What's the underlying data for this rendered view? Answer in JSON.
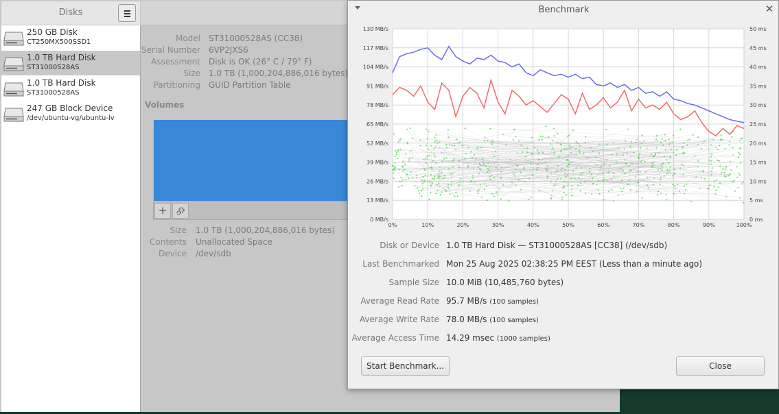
{
  "sidebar": {
    "title": "Disks",
    "disks": [
      {
        "name": "250 GB Disk",
        "sub": "CT250MX500SSD1"
      },
      {
        "name": "1.0 TB Hard Disk",
        "sub": "ST31000528AS"
      },
      {
        "name": "1.0 TB Hard Disk",
        "sub": "ST31000528AS"
      },
      {
        "name": "247 GB Block Device",
        "sub": "/dev/ubuntu-vg/ubuntu-lv"
      }
    ]
  },
  "details": {
    "model_label": "Model",
    "model": "ST31000528AS (CC38)",
    "serial_label": "Serial Number",
    "serial": "6VP2JXS6",
    "assessment_label": "Assessment",
    "assessment": "Disk is OK (26° C / 79° F)",
    "size_label": "Size",
    "size": "1.0 TB (1,000,204,886,016 bytes)",
    "partitioning_label": "Partitioning",
    "partitioning": "GUID Partition Table"
  },
  "volumes": {
    "heading": "Volumes",
    "add_label": "+",
    "size_label": "Size",
    "size": "1.0 TB (1,000,204,886,016 bytes)",
    "contents_label": "Contents",
    "contents": "Unallocated Space",
    "device_label": "Device",
    "device": "/dev/sdb"
  },
  "benchmark": {
    "title": "Benchmark",
    "disk_label": "Disk or Device",
    "disk": "1.0 TB Hard Disk — ST31000528AS [CC38] (/dev/sdb)",
    "last_label": "Last Benchmarked",
    "last": "Mon 25 Aug 2025 02:38:25 PM EEST (Less than a minute ago)",
    "sample_size_label": "Sample Size",
    "sample_size": "10.0 MiB (10,485,760 bytes)",
    "read_label": "Average Read Rate",
    "read": "95.7 MB/s",
    "read_samples": "(100 samples)",
    "write_label": "Average Write Rate",
    "write": "78.0 MB/s",
    "write_samples": "(100 samples)",
    "access_label": "Average Access Time",
    "access": "14.29 msec",
    "access_samples": "(1000 samples)",
    "start_button": "Start Benchmark...",
    "close_button": "Close"
  },
  "chart_data": {
    "type": "line",
    "x_unit": "%",
    "x_ticks": [
      "0%",
      "10%",
      "20%",
      "30%",
      "40%",
      "50%",
      "60%",
      "70%",
      "80%",
      "90%",
      "100%"
    ],
    "y_left_ticks": [
      "0 MB/s",
      "13 MB/s",
      "26 MB/s",
      "39 MB/s",
      "52 MB/s",
      "65 MB/s",
      "78 MB/s",
      "91 MB/s",
      "104 MB/s",
      "117 MB/s",
      "130 MB/s"
    ],
    "y_right_ticks": [
      "0 ms",
      "5 ms",
      "10 ms",
      "15 ms",
      "20 ms",
      "25 ms",
      "30 ms",
      "35 ms",
      "40 ms",
      "45 ms",
      "50 ms"
    ],
    "ylim_left": [
      0,
      130
    ],
    "ylim_right": [
      0,
      50
    ],
    "grid": true,
    "colors": {
      "read": "#6b6bf0",
      "write": "#f06b6b",
      "access": "#4bd84b"
    },
    "series": [
      {
        "key": "read",
        "axis": "left",
        "x": [
          0,
          2,
          4,
          6,
          8,
          10,
          12,
          14,
          16,
          18,
          20,
          22,
          24,
          26,
          28,
          30,
          32,
          34,
          36,
          38,
          40,
          42,
          44,
          46,
          48,
          50,
          52,
          54,
          56,
          58,
          60,
          62,
          64,
          66,
          68,
          70,
          72,
          74,
          76,
          78,
          80,
          82,
          84,
          86,
          88,
          90,
          92,
          94,
          96,
          98,
          100
        ],
        "values": [
          100,
          111,
          113,
          114,
          116,
          117,
          112,
          109,
          118,
          111,
          108,
          106,
          110,
          109,
          112,
          108,
          107,
          104,
          106,
          100,
          98,
          102,
          100,
          98,
          99,
          97,
          99,
          96,
          97,
          92,
          91,
          93,
          90,
          92,
          88,
          90,
          86,
          87,
          84,
          87,
          82,
          81,
          79,
          78,
          76,
          74,
          72,
          70,
          68,
          67,
          66
        ]
      },
      {
        "key": "write",
        "axis": "left",
        "x": [
          0,
          2,
          4,
          6,
          8,
          10,
          12,
          14,
          16,
          18,
          20,
          22,
          24,
          26,
          28,
          30,
          32,
          34,
          36,
          38,
          40,
          42,
          44,
          46,
          48,
          50,
          52,
          54,
          56,
          58,
          60,
          62,
          64,
          66,
          68,
          70,
          72,
          74,
          76,
          78,
          80,
          82,
          84,
          86,
          88,
          90,
          92,
          94,
          96,
          98,
          100
        ],
        "values": [
          85,
          90,
          88,
          84,
          91,
          80,
          75,
          93,
          88,
          70,
          84,
          90,
          86,
          76,
          95,
          80,
          72,
          88,
          84,
          78,
          81,
          77,
          73,
          79,
          85,
          82,
          72,
          86,
          75,
          78,
          83,
          76,
          80,
          88,
          74,
          82,
          76,
          78,
          75,
          80,
          72,
          68,
          70,
          74,
          66,
          60,
          57,
          62,
          58,
          64,
          62
        ]
      },
      {
        "key": "access",
        "axis": "right",
        "note": "1000 scattered samples, mostly 5–25 ms",
        "mean_ms": 14.29
      }
    ]
  }
}
